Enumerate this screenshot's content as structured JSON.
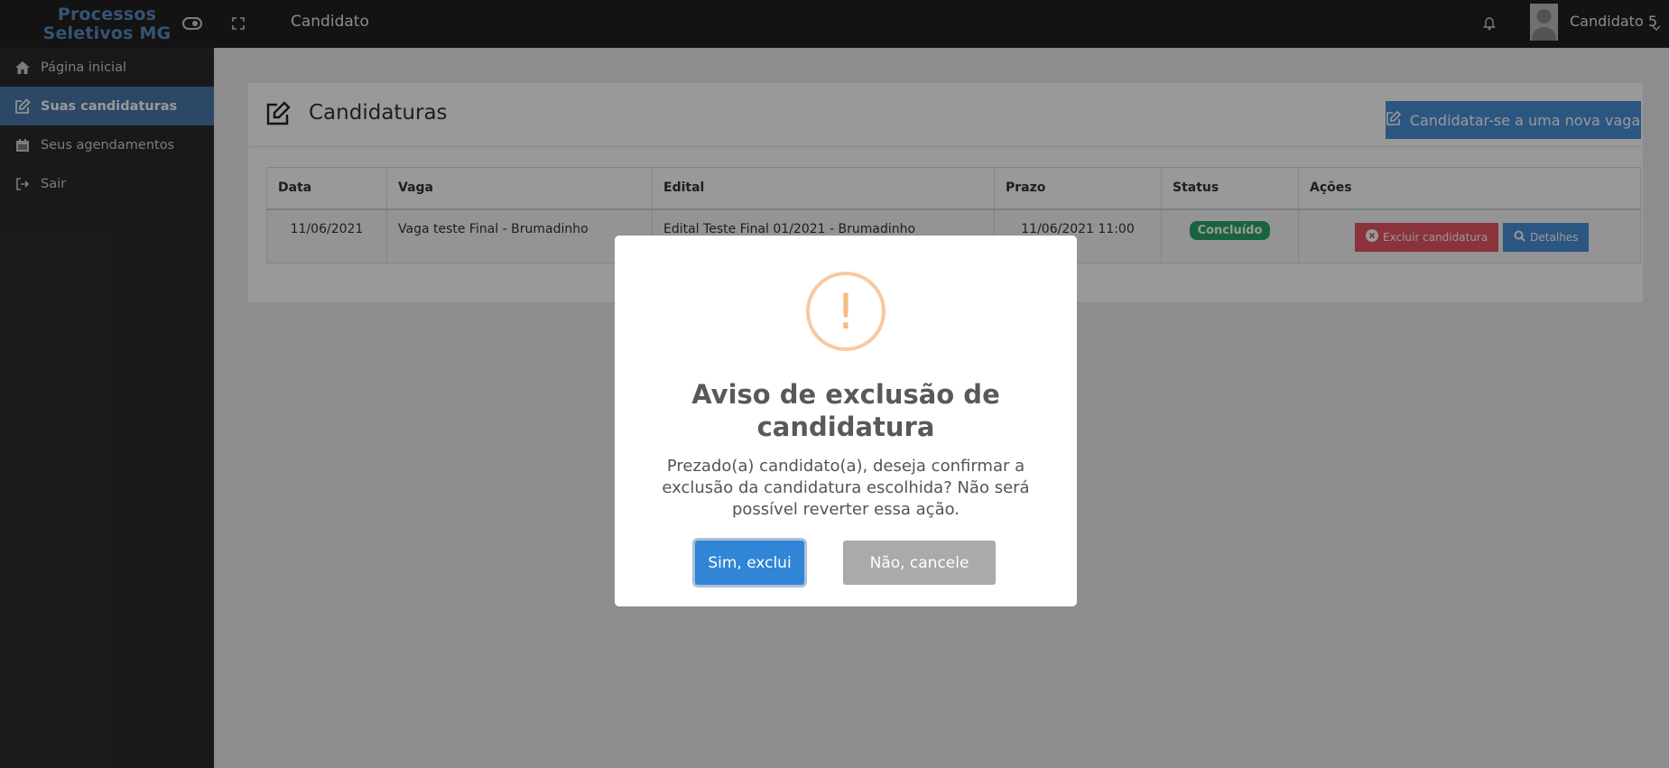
{
  "brand": {
    "line1": "Processos",
    "line2": "Seletivos MG"
  },
  "topbar": {
    "title": "Candidato",
    "username": "Candidato 5"
  },
  "sidebar": {
    "items": [
      {
        "label": "Página inicial",
        "icon": "home-icon",
        "active": false
      },
      {
        "label": "Suas candidaturas",
        "icon": "edit-icon",
        "active": true
      },
      {
        "label": "Seus agendamentos",
        "icon": "calendar-icon",
        "active": false
      },
      {
        "label": "Sair",
        "icon": "sign-out-icon",
        "active": false
      }
    ]
  },
  "main": {
    "title": "Candidaturas",
    "new_button_label": "Candidatar-se a uma nova vaga",
    "table": {
      "headers": [
        "Data",
        "Vaga",
        "Edital",
        "Prazo",
        "Status",
        "Ações"
      ],
      "rows": [
        {
          "data": "11/06/2021",
          "vaga": "Vaga teste Final - Brumadinho",
          "edital": "Edital Teste Final 01/2021 - Brumadinho",
          "prazo": "11/06/2021 11:00",
          "status": "Concluído",
          "delete_label": "Excluir candidatura",
          "details_label": "Detalhes"
        }
      ]
    }
  },
  "modal": {
    "icon_glyph": "!",
    "title": "Aviso de exclusão de candidatura",
    "text": "Prezado(a) candidato(a), deseja confirmar a exclusão da candidatura escolhida? Não será possível reverter essa ação.",
    "confirm_label": "Sim, exclui",
    "cancel_label": "Não, cancele"
  },
  "colors": {
    "topbar": "#212121",
    "sidebar": "#2b2b2b",
    "sidebar_active": "#4a79ab",
    "primary": "#3085d6",
    "danger": "#e65561",
    "success": "#2ea56b",
    "warning": "#f8bb86"
  }
}
